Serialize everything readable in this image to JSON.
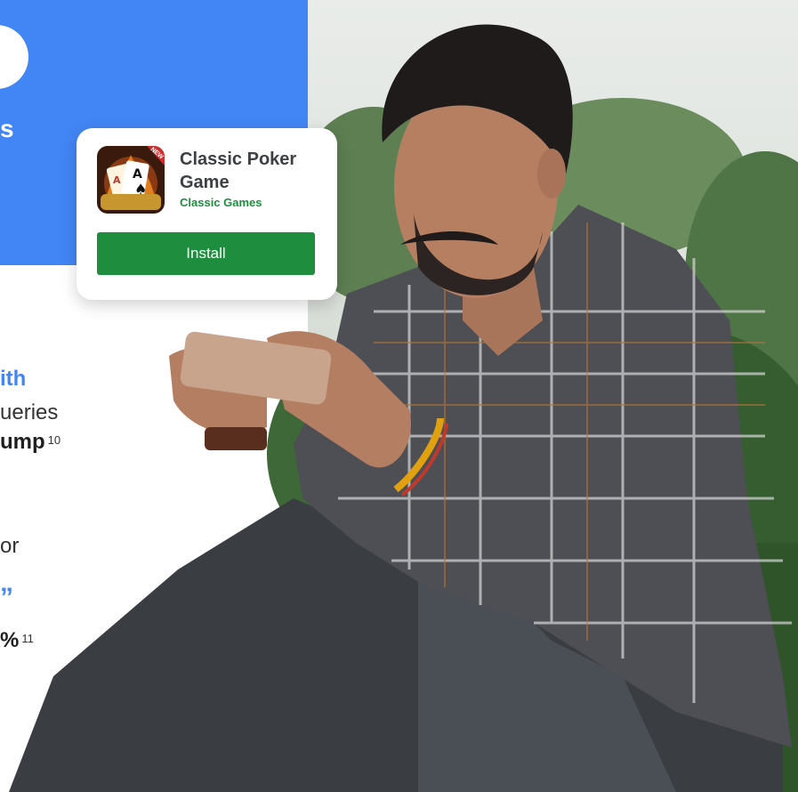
{
  "left_column": {
    "heading_fragment": "s",
    "line1": "ith",
    "line2": "ueries",
    "line3": "ump",
    "line3_footnote": "10",
    "line4": "or",
    "quote_mark": "”",
    "line5": "%",
    "line5_footnote": "11"
  },
  "app_card": {
    "title": "Classic Poker Game",
    "developer": "Classic Games",
    "install_label": "Install",
    "icon_badge": "NEW"
  },
  "colors": {
    "blue": "#4285f4",
    "green": "#1e8e3e"
  }
}
